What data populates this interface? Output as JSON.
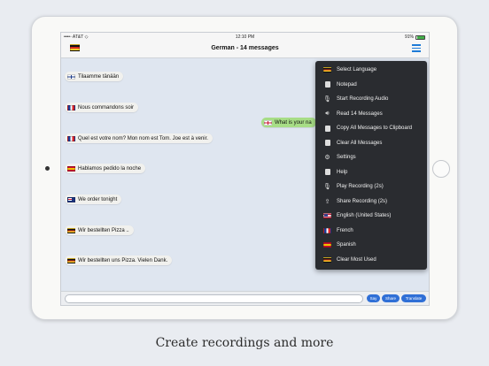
{
  "status_bar": {
    "carrier": "••••◦ AT&T ◇",
    "time": "12:10 PM",
    "battery": "91%"
  },
  "nav": {
    "title": "German - 14 messages",
    "flag_icon": "german-flag-icon",
    "menu_icon": "hamburger-menu-icon"
  },
  "messages": [
    {
      "text": "Tilaamme tänään",
      "flag": "finnish-flag-icon"
    },
    {
      "text": "Nous commandons soir",
      "flag": "french-flag-icon"
    },
    {
      "text": "What is your na",
      "flag": "british-flag-icon"
    },
    {
      "text": "Quel est votre nom? Mon nom est Tom. Joe est à venir.",
      "flag": "french-flag-icon"
    },
    {
      "text": "Hablamos pedido la noche",
      "flag": "spanish-flag-icon"
    },
    {
      "text": "We order tonight",
      "flag": "australian-flag-icon"
    },
    {
      "text": "Wir bestellten Pizza ..",
      "flag": "german-flag-icon"
    },
    {
      "text": "Wir bestellten uns Pizza. Vielen Dank.",
      "flag": "german-flag-icon"
    }
  ],
  "menu": {
    "items": [
      {
        "label": "Select Language",
        "icon": "german-flag-icon"
      },
      {
        "label": "Notepad",
        "icon": "notepad-icon"
      },
      {
        "label": "Start Recording Audio",
        "icon": "microphone-icon"
      },
      {
        "label": "Read 14 Messages",
        "icon": "speaker-icon"
      },
      {
        "label": "Copy All Messages to Clipboard",
        "icon": "clipboard-icon"
      },
      {
        "label": "Clear All Messages",
        "icon": "clear-icon"
      },
      {
        "label": "Settings",
        "icon": "gear-icon"
      },
      {
        "label": "Help",
        "icon": "help-icon"
      },
      {
        "label": "Play Recording (2s)",
        "icon": "play-recording-icon"
      },
      {
        "label": "Share Recording (2s)",
        "icon": "share-icon"
      },
      {
        "label": "English (United States)",
        "icon": "us-flag-icon"
      },
      {
        "label": "French",
        "icon": "french-flag-icon"
      },
      {
        "label": "Spanish",
        "icon": "spanish-flag-icon"
      },
      {
        "label": "Clear Most Used",
        "icon": "german-flag-icon"
      }
    ]
  },
  "bottom_bar": {
    "input_placeholder": "",
    "buttons": [
      "Say",
      "Share",
      "Translate"
    ]
  },
  "caption": "Create recordings and more",
  "colors": {
    "accent": "#1e7bd8",
    "menu_bg": "#2a2c30",
    "bubble_green": "#a7dd86",
    "screen_bg": "#dfe6f0"
  }
}
